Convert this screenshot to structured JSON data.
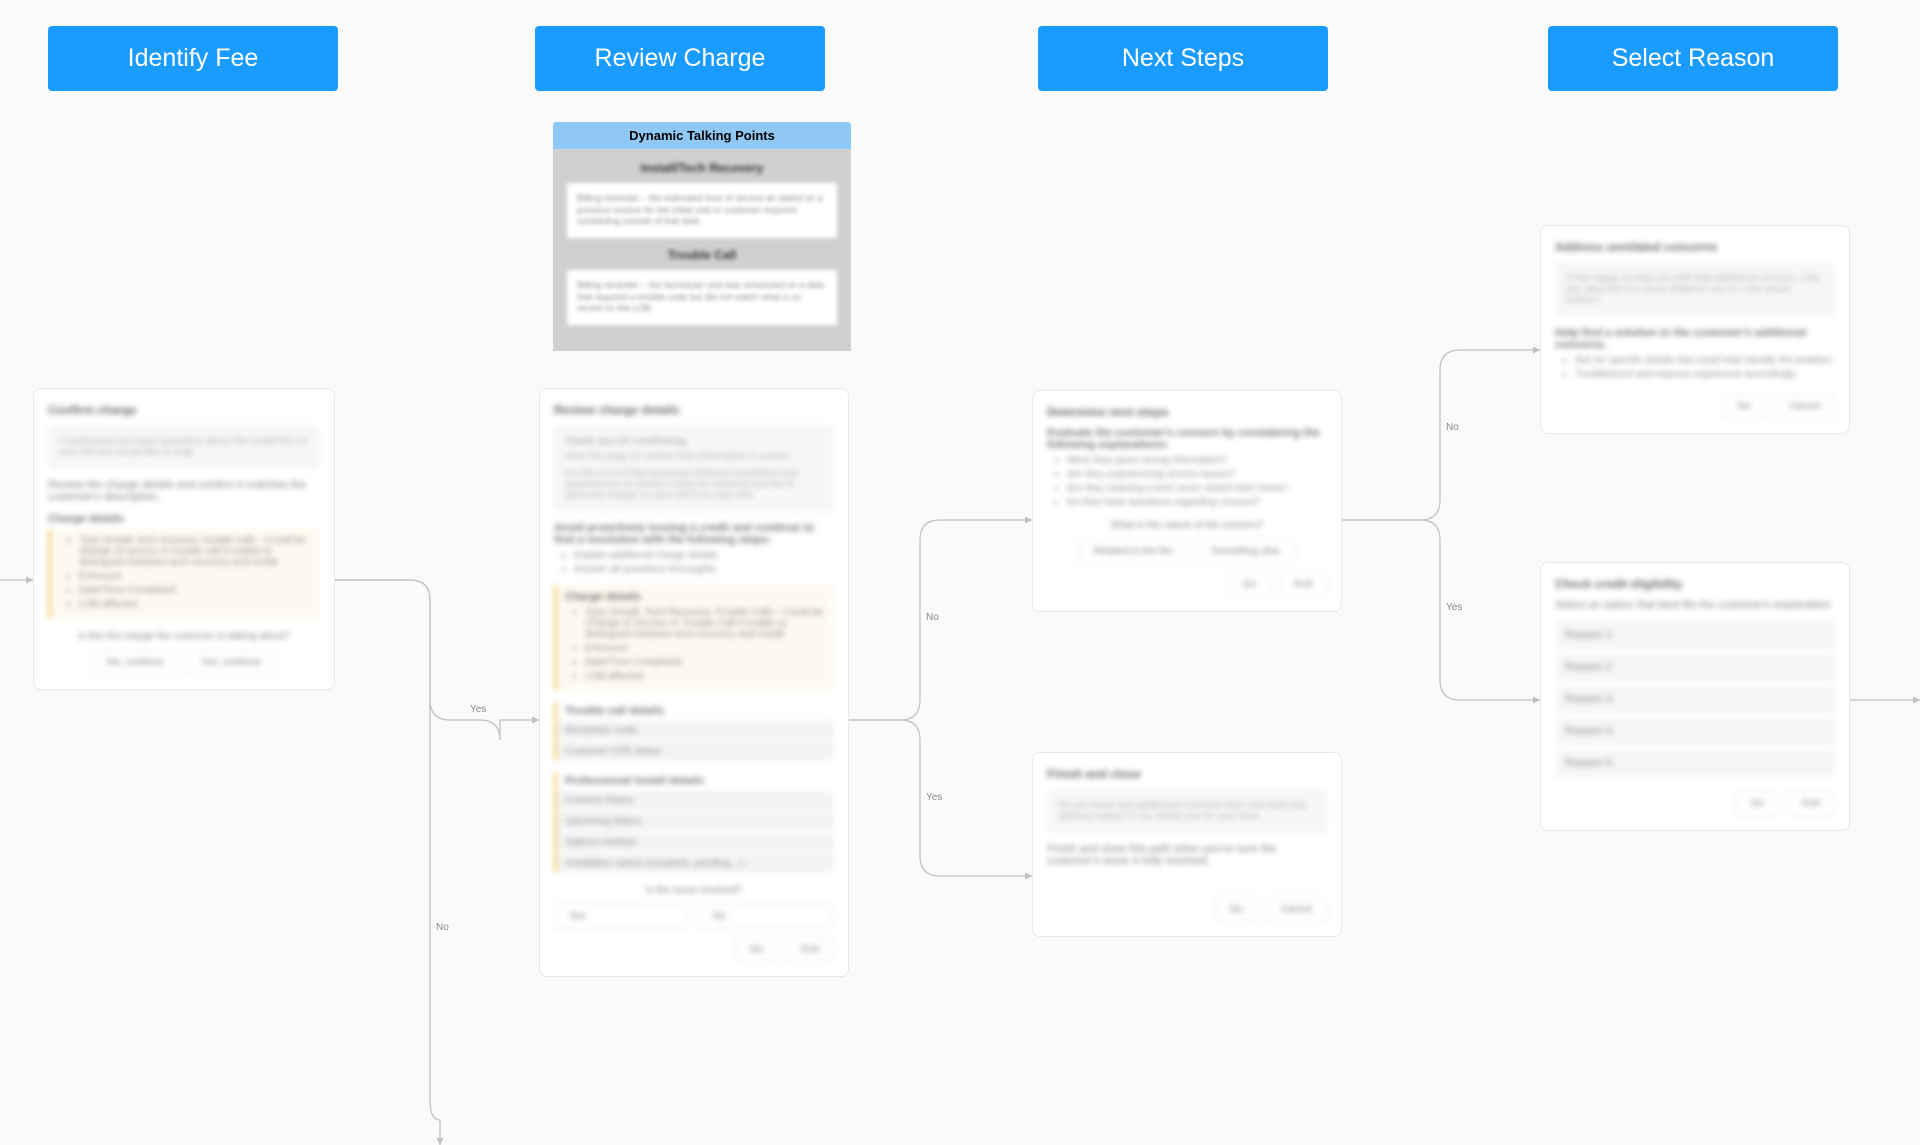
{
  "columns": {
    "c1": "Identify Fee",
    "c2": "Review Charge",
    "c3": "Next Steps",
    "c4": "Select Reason"
  },
  "dtp": {
    "header": "Dynamic Talking Points",
    "sec1_title": "Install/Tech Recovery",
    "sec1_body": "Billing reminder – the estimated time of service as stated on a previous invoice for the initial visit or customer-required scheduling outside of that date.",
    "sec2_title": "Trouble Call",
    "sec2_body": "Billing reminder – the technician visit was scheduled on a date that required a trouble code but did not match what is on record on the LOB."
  },
  "confirm": {
    "title": "Confirm charge",
    "muted": "I understand you have questions about the install fee on your bill and would like to help.",
    "desc": "Review the charge details and confirm it matches the customer's description.",
    "section": "Charge details",
    "items": [
      "Type (install, tech recovery, trouble call) – Could be change of service or trouble call if unable to distinguish between tech recovery and install",
      "$ Amount",
      "Date/Time Completed",
      "LOB affected"
    ],
    "question": "Is this the charge the customer is talking about?",
    "btn1": "No, continue",
    "btn2": "Yes, continue"
  },
  "review": {
    "title": "Review charge details",
    "muted_title": "Thank you for confirming.",
    "muted_line": "View the page to confirm that information is correct.",
    "muted_line2": "On the record that technician [Name] completed your appointment on [date] in [city] for [reason] and the $ [amount] charge on your bill is for that visit.",
    "avoid": "Avoid proactively issuing a credit and continue to find a resolution with the following steps:",
    "avoid_items": [
      "Explain additional charge details",
      "Answer all questions thoroughly"
    ],
    "charge_section": "Charge details",
    "charge_items": [
      "Type (Install, Tech Recovery, Trouble Call) – Could be Change of Service or Trouble Call if unable to distinguish between tech recovery and install",
      "$ Amount",
      "Date/Time Completed",
      "LOB affected"
    ],
    "trouble_section": "Trouble call details",
    "trouble_items": [
      "Resolution code",
      "Customer CPE status"
    ],
    "prof_section": "Professional install details",
    "prof_items": [
      "Connect Status",
      "Upcoming Status",
      "Options method",
      "Installation status (complete, pending…)"
    ],
    "question": "Is the issue resolved?",
    "btn_yes": "Yes",
    "btn_no": "No",
    "btn_go": "Go",
    "btn_cancel": "End"
  },
  "determine": {
    "title": "Determine next steps",
    "desc": "Evaluate the customer's concern by considering the following explanations:",
    "items": [
      "Were they given wrong information?",
      "Are they experiencing service issues?",
      "Are they claiming a tech never visited their home?",
      "Do they have questions regarding consent?"
    ],
    "question": "What is the nature of the concern?",
    "btn1": "Related to the fee",
    "btn2": "Something else",
    "btn_go": "Go",
    "btn_end": "End"
  },
  "finish": {
    "title": "Finish and close",
    "muted": "Do you have any additional concerns that I can help you address today? If not, thank you for your time.",
    "desc": "Finish and close this path when you're sure the customer's issue is fully resolved.",
    "btn_go": "Go",
    "btn_cancel": "Cancel"
  },
  "address": {
    "title": "Address unrelated concerns",
    "muted": "I'd be happy to help you with that additional concern. Can you describe it in more detail for me so I can assist further?",
    "desc": "Help find a solution to the customer's additional concerns.",
    "items": [
      "Ask for specific details that could help identify the problem.",
      "Troubleshoot and express experience accordingly."
    ],
    "btn_go": "Go",
    "btn_cancel": "Cancel"
  },
  "eligible": {
    "title": "Check credit eligibility",
    "desc": "Select an option that best fits the customer's explanation.",
    "reasons": [
      "Reason 1",
      "Reason 2",
      "Reason 3",
      "Reason 4",
      "Reason 5"
    ],
    "btn_go": "Go",
    "btn_end": "End"
  },
  "labels": {
    "yes": "Yes",
    "no": "No"
  }
}
